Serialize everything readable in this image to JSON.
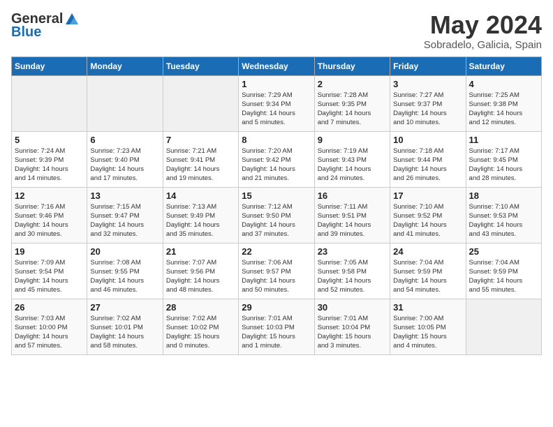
{
  "logo": {
    "general": "General",
    "blue": "Blue"
  },
  "header": {
    "month": "May 2024",
    "location": "Sobradelo, Galicia, Spain"
  },
  "weekdays": [
    "Sunday",
    "Monday",
    "Tuesday",
    "Wednesday",
    "Thursday",
    "Friday",
    "Saturday"
  ],
  "weeks": [
    [
      {
        "day": "",
        "info": ""
      },
      {
        "day": "",
        "info": ""
      },
      {
        "day": "",
        "info": ""
      },
      {
        "day": "1",
        "info": "Sunrise: 7:29 AM\nSunset: 9:34 PM\nDaylight: 14 hours\nand 5 minutes."
      },
      {
        "day": "2",
        "info": "Sunrise: 7:28 AM\nSunset: 9:35 PM\nDaylight: 14 hours\nand 7 minutes."
      },
      {
        "day": "3",
        "info": "Sunrise: 7:27 AM\nSunset: 9:37 PM\nDaylight: 14 hours\nand 10 minutes."
      },
      {
        "day": "4",
        "info": "Sunrise: 7:25 AM\nSunset: 9:38 PM\nDaylight: 14 hours\nand 12 minutes."
      }
    ],
    [
      {
        "day": "5",
        "info": "Sunrise: 7:24 AM\nSunset: 9:39 PM\nDaylight: 14 hours\nand 14 minutes."
      },
      {
        "day": "6",
        "info": "Sunrise: 7:23 AM\nSunset: 9:40 PM\nDaylight: 14 hours\nand 17 minutes."
      },
      {
        "day": "7",
        "info": "Sunrise: 7:21 AM\nSunset: 9:41 PM\nDaylight: 14 hours\nand 19 minutes."
      },
      {
        "day": "8",
        "info": "Sunrise: 7:20 AM\nSunset: 9:42 PM\nDaylight: 14 hours\nand 21 minutes."
      },
      {
        "day": "9",
        "info": "Sunrise: 7:19 AM\nSunset: 9:43 PM\nDaylight: 14 hours\nand 24 minutes."
      },
      {
        "day": "10",
        "info": "Sunrise: 7:18 AM\nSunset: 9:44 PM\nDaylight: 14 hours\nand 26 minutes."
      },
      {
        "day": "11",
        "info": "Sunrise: 7:17 AM\nSunset: 9:45 PM\nDaylight: 14 hours\nand 28 minutes."
      }
    ],
    [
      {
        "day": "12",
        "info": "Sunrise: 7:16 AM\nSunset: 9:46 PM\nDaylight: 14 hours\nand 30 minutes."
      },
      {
        "day": "13",
        "info": "Sunrise: 7:15 AM\nSunset: 9:47 PM\nDaylight: 14 hours\nand 32 minutes."
      },
      {
        "day": "14",
        "info": "Sunrise: 7:13 AM\nSunset: 9:49 PM\nDaylight: 14 hours\nand 35 minutes."
      },
      {
        "day": "15",
        "info": "Sunrise: 7:12 AM\nSunset: 9:50 PM\nDaylight: 14 hours\nand 37 minutes."
      },
      {
        "day": "16",
        "info": "Sunrise: 7:11 AM\nSunset: 9:51 PM\nDaylight: 14 hours\nand 39 minutes."
      },
      {
        "day": "17",
        "info": "Sunrise: 7:10 AM\nSunset: 9:52 PM\nDaylight: 14 hours\nand 41 minutes."
      },
      {
        "day": "18",
        "info": "Sunrise: 7:10 AM\nSunset: 9:53 PM\nDaylight: 14 hours\nand 43 minutes."
      }
    ],
    [
      {
        "day": "19",
        "info": "Sunrise: 7:09 AM\nSunset: 9:54 PM\nDaylight: 14 hours\nand 45 minutes."
      },
      {
        "day": "20",
        "info": "Sunrise: 7:08 AM\nSunset: 9:55 PM\nDaylight: 14 hours\nand 46 minutes."
      },
      {
        "day": "21",
        "info": "Sunrise: 7:07 AM\nSunset: 9:56 PM\nDaylight: 14 hours\nand 48 minutes."
      },
      {
        "day": "22",
        "info": "Sunrise: 7:06 AM\nSunset: 9:57 PM\nDaylight: 14 hours\nand 50 minutes."
      },
      {
        "day": "23",
        "info": "Sunrise: 7:05 AM\nSunset: 9:58 PM\nDaylight: 14 hours\nand 52 minutes."
      },
      {
        "day": "24",
        "info": "Sunrise: 7:04 AM\nSunset: 9:59 PM\nDaylight: 14 hours\nand 54 minutes."
      },
      {
        "day": "25",
        "info": "Sunrise: 7:04 AM\nSunset: 9:59 PM\nDaylight: 14 hours\nand 55 minutes."
      }
    ],
    [
      {
        "day": "26",
        "info": "Sunrise: 7:03 AM\nSunset: 10:00 PM\nDaylight: 14 hours\nand 57 minutes."
      },
      {
        "day": "27",
        "info": "Sunrise: 7:02 AM\nSunset: 10:01 PM\nDaylight: 14 hours\nand 58 minutes."
      },
      {
        "day": "28",
        "info": "Sunrise: 7:02 AM\nSunset: 10:02 PM\nDaylight: 15 hours\nand 0 minutes."
      },
      {
        "day": "29",
        "info": "Sunrise: 7:01 AM\nSunset: 10:03 PM\nDaylight: 15 hours\nand 1 minute."
      },
      {
        "day": "30",
        "info": "Sunrise: 7:01 AM\nSunset: 10:04 PM\nDaylight: 15 hours\nand 3 minutes."
      },
      {
        "day": "31",
        "info": "Sunrise: 7:00 AM\nSunset: 10:05 PM\nDaylight: 15 hours\nand 4 minutes."
      },
      {
        "day": "",
        "info": ""
      }
    ]
  ]
}
